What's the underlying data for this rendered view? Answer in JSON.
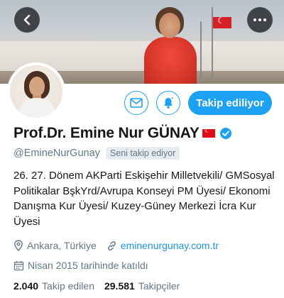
{
  "profile": {
    "name": "Prof.Dr. Emine Nur GÜNAY",
    "handle": "@EmineNurGunay",
    "follows_you": "Seni takip ediyor",
    "bio": "26. 27. Dönem AKParti Eskişehir Milletvekili/ GMSosyal Politikalar BşkYrd/Avrupa Konseyi PM Üyesi/ Ekonomi Danışma Kur Üyesi/ Kuzey-Güney Merkezi İcra Kur Üyesi",
    "location": "Ankara, Türkiye",
    "website": "eminenurgunay.com.tr",
    "joined": "Nisan 2015 tarihinde katıldı"
  },
  "actions": {
    "follow_label": "Takip ediliyor"
  },
  "stats": {
    "following_count": "2.040",
    "following_label": "Takip edilen",
    "followers_count": "29.581",
    "followers_label": "Takipçiler"
  },
  "icons": {
    "back": "back-arrow-icon",
    "more": "more-icon",
    "mail": "envelope-icon",
    "notifications": "bell-icon",
    "verified": "verified-badge-icon",
    "flag": "turkey-flag-icon",
    "location": "location-pin-icon",
    "link": "link-icon",
    "calendar": "calendar-icon"
  },
  "colors": {
    "accent": "#1da1f2",
    "secondary_text": "#657786",
    "link": "#1b95e0"
  }
}
